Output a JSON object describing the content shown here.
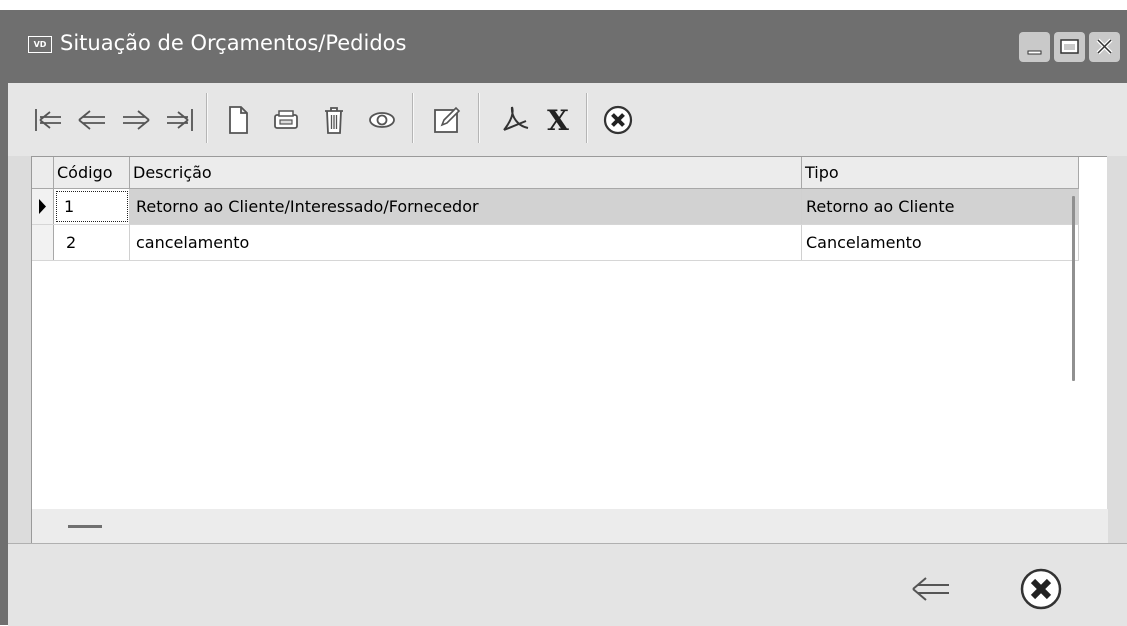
{
  "window": {
    "icon_text": "VD",
    "title": "Situação de Orçamentos/Pedidos"
  },
  "titlebar_buttons": [
    "minimize",
    "maximize",
    "close"
  ],
  "toolbar": {
    "buttons": [
      {
        "icon": "first-record-icon"
      },
      {
        "icon": "previous-record-icon"
      },
      {
        "icon": "next-record-icon"
      },
      {
        "icon": "last-record-icon"
      },
      {
        "icon": "new-document-icon"
      },
      {
        "icon": "print-icon"
      },
      {
        "icon": "delete-icon"
      },
      {
        "icon": "view-icon"
      },
      {
        "icon": "edit-icon"
      },
      {
        "icon": "pdf-icon"
      },
      {
        "icon": "excel-icon",
        "text": "X"
      },
      {
        "icon": "cancel-icon"
      }
    ]
  },
  "grid": {
    "columns": [
      "Código",
      "Descrição",
      "Tipo"
    ],
    "rows": [
      {
        "codigo": "1",
        "descricao": "Retorno ao Cliente/Interessado/Fornecedor",
        "tipo": "Retorno ao Cliente",
        "selected": true
      },
      {
        "codigo": "2",
        "descricao": "cancelamento",
        "tipo": "Cancelamento",
        "selected": false
      }
    ]
  },
  "bottom": {
    "buttons": [
      {
        "icon": "back-arrow-icon"
      },
      {
        "icon": "close-circle-icon"
      }
    ]
  },
  "colors": {
    "titlebar": "#6f6f6f",
    "toolbar": "#e6e6e6",
    "selected_row": "#d2d2d2"
  }
}
